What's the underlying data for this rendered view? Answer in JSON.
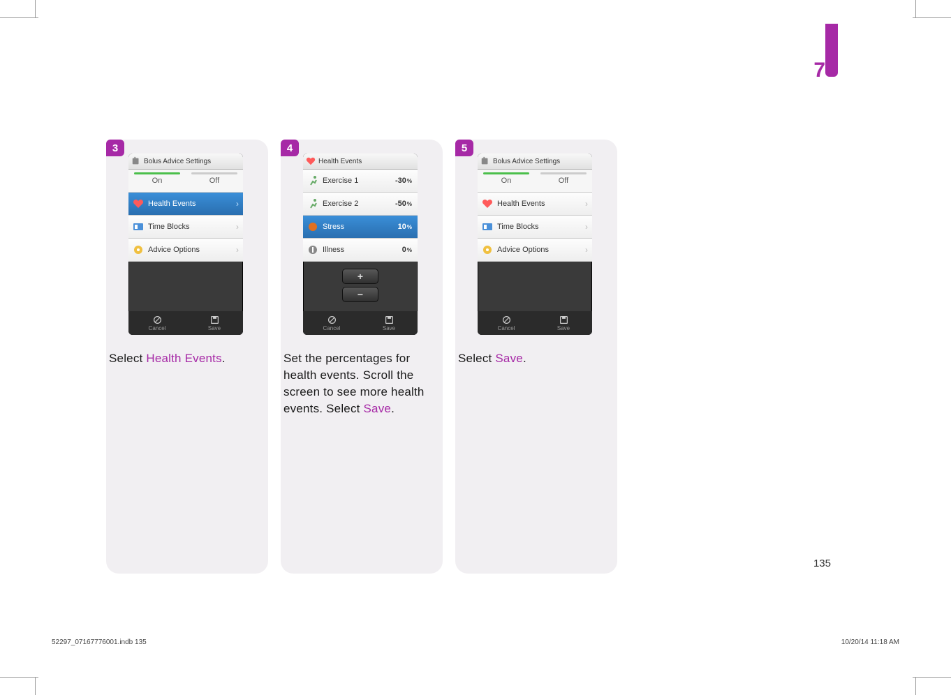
{
  "chapter": "7",
  "page_number": "135",
  "slug_left": "52297_07167776001.indb   135",
  "slug_right": "10/20/14   11:18 AM",
  "steps": [
    {
      "num": "3",
      "title": "Bolus Advice Settings",
      "onoff": {
        "on": "On",
        "off": "Off"
      },
      "rows": [
        {
          "label": "Health Events",
          "selected": true
        },
        {
          "label": "Time Blocks"
        },
        {
          "label": "Advice Options"
        }
      ],
      "footer": {
        "cancel": "Cancel",
        "save": "Save"
      },
      "caption_pre": "Select ",
      "caption_hl": "Health Events",
      "caption_post": "."
    },
    {
      "num": "4",
      "title": "Health Events",
      "events": [
        {
          "label": "Exercise 1",
          "val": "-30",
          "sel": false,
          "ico": "run"
        },
        {
          "label": "Exercise 2",
          "val": "-50",
          "sel": false,
          "ico": "run"
        },
        {
          "label": "Stress",
          "val": "10",
          "sel": true,
          "ico": "stress"
        },
        {
          "label": "Illness",
          "val": "0",
          "sel": false,
          "ico": "ill"
        }
      ],
      "footer": {
        "cancel": "Cancel",
        "save": "Save"
      },
      "caption_full": "Set the percentages for health events. Scroll the screen to see more health events. Select ",
      "caption_hl": "Save",
      "caption_post": "."
    },
    {
      "num": "5",
      "title": "Bolus Advice Settings",
      "onoff": {
        "on": "On",
        "off": "Off"
      },
      "rows": [
        {
          "label": "Health Events"
        },
        {
          "label": "Time Blocks"
        },
        {
          "label": "Advice Options"
        }
      ],
      "footer": {
        "cancel": "Cancel",
        "save": "Save"
      },
      "caption_pre": "Select ",
      "caption_hl": "Save",
      "caption_post": "."
    }
  ]
}
